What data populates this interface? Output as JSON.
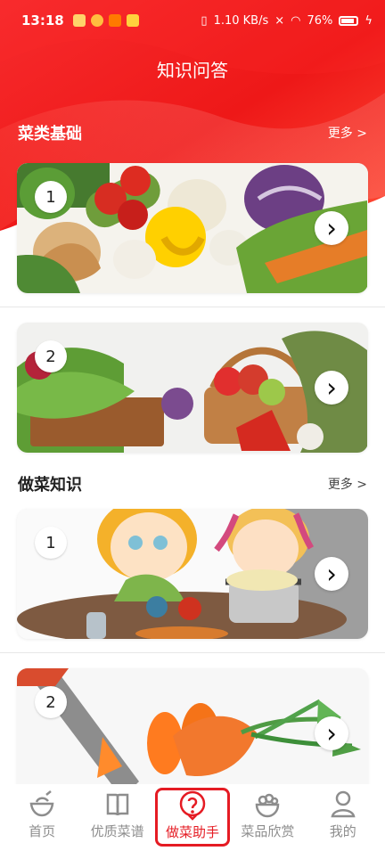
{
  "status_bar": {
    "time": "13:18",
    "network_speed": "1.10 KB/s",
    "battery": "76%"
  },
  "header": {
    "title": "知识问答"
  },
  "sections": [
    {
      "title": "菜类基础",
      "more": "更多 >",
      "cards": [
        {
          "number": "1"
        },
        {
          "number": "2"
        }
      ]
    },
    {
      "title": "做菜知识",
      "more": "更多 >",
      "cards": [
        {
          "number": "1"
        },
        {
          "number": "2"
        }
      ]
    }
  ],
  "bottom_nav": {
    "items": [
      {
        "label": "首页",
        "icon": "home-bowl-icon"
      },
      {
        "label": "优质菜谱",
        "icon": "recipe-book-icon"
      },
      {
        "label": "做菜助手",
        "icon": "question-icon",
        "active": true
      },
      {
        "label": "菜品欣赏",
        "icon": "dish-icon"
      },
      {
        "label": "我的",
        "icon": "user-icon"
      }
    ]
  },
  "colors": {
    "brand_red": "#e51b23",
    "nav_gray": "#8d8d8d"
  }
}
